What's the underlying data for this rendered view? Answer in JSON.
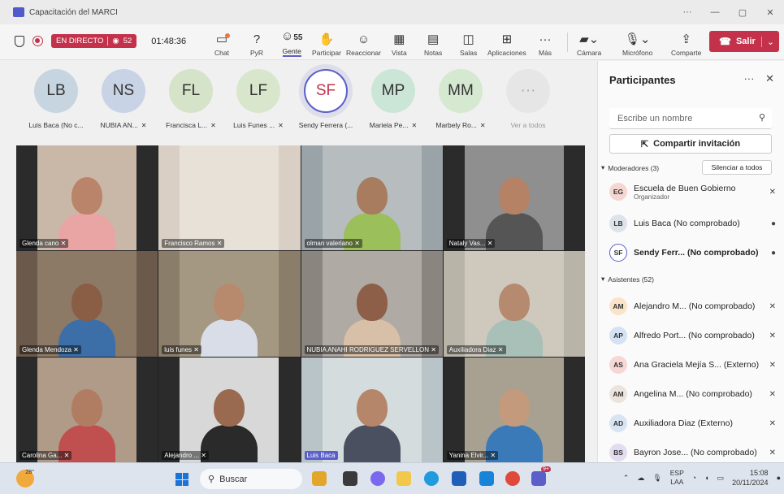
{
  "window": {
    "title": "Capacitación del MARCI",
    "more": "···",
    "minimize": "—",
    "restore": "▢",
    "close": "✕"
  },
  "toolbar": {
    "live_label": "EN DIRECTO",
    "viewers": "52",
    "timer": "01:48:36",
    "people_count": "55",
    "buttons": [
      {
        "label": "Chat",
        "icon": "chat-icon"
      },
      {
        "label": "PyR",
        "icon": "qa-icon"
      },
      {
        "label": "Gente",
        "icon": "people-icon"
      },
      {
        "label": "Participar",
        "icon": "raise-hand-icon"
      },
      {
        "label": "Reaccionar",
        "icon": "smiley-icon"
      },
      {
        "label": "Vista",
        "icon": "grid-icon"
      },
      {
        "label": "Notas",
        "icon": "notes-icon"
      },
      {
        "label": "Salas",
        "icon": "rooms-icon"
      },
      {
        "label": "Aplicaciones",
        "icon": "plus-square-icon"
      },
      {
        "label": "Más",
        "icon": "ellipsis-icon"
      }
    ],
    "camera": "Cámara",
    "mic": "Micrófono",
    "share": "Comparte",
    "leave": "Salir"
  },
  "avatars": [
    {
      "initials": "LB",
      "name": "Luis Baca (No c...",
      "color": "#c7d5e0",
      "muted": false
    },
    {
      "initials": "NS",
      "name": "NUBIA AN...",
      "color": "#c9d3e6",
      "muted": true
    },
    {
      "initials": "FL",
      "name": "Francisca L...",
      "color": "#d5e3c9",
      "muted": true
    },
    {
      "initials": "LF",
      "name": "Luis Funes ...",
      "color": "#d8e6cc",
      "muted": true
    },
    {
      "initials": "SF",
      "name": "Sendy Ferrera (...",
      "color": "#f3dede",
      "muted": false
    },
    {
      "initials": "MP",
      "name": "Mariela Pe...",
      "color": "#cbe6d6",
      "muted": true
    },
    {
      "initials": "MM",
      "name": "Marbely Ro...",
      "color": "#d5e8d0",
      "muted": true
    },
    {
      "initials": "···",
      "name": "Ver a todos",
      "color": "#e6e6e6",
      "muted": false
    }
  ],
  "tiles": [
    {
      "name": "Glenda cano",
      "bg": "#2b2b2b",
      "scene": "#c9b8a8",
      "skin": "#b9846a",
      "shirt": "#e9a4a4"
    },
    {
      "name": "Francisco  Ramos",
      "bg": "#d9cfc4",
      "scene": "#e8e1d8",
      "skin": "#d9cfc4",
      "shirt": "#d9cfc4"
    },
    {
      "name": "olman valeriano",
      "bg": "#9aa3a8",
      "scene": "#b7bcbf",
      "skin": "#a87c5f",
      "shirt": "#9bbf5a"
    },
    {
      "name": "Nataly Vas...",
      "bg": "#2b2b2b",
      "scene": "#8f8f8f",
      "skin": "#b58266",
      "shirt": "#555555"
    },
    {
      "name": "Glenda Mendoza",
      "bg": "#6b5a4b",
      "scene": "#8d7a66",
      "skin": "#8a5d45",
      "shirt": "#3c6fa8"
    },
    {
      "name": "luis funes",
      "bg": "#8a7d6a",
      "scene": "#a59883",
      "skin": "#b88a6d",
      "shirt": "#d8dde8"
    },
    {
      "name": "NUBIA ANAHI RODRIGUEZ SERVELLON",
      "bg": "#8b8580",
      "scene": "#b0aaa4",
      "skin": "#8d5f48",
      "shirt": "#d8c0a8"
    },
    {
      "name": "Auxiliadora Diaz",
      "bg": "#b9b4a8",
      "scene": "#cfc9bd",
      "skin": "#b58a6f",
      "shirt": "#a8c0b8"
    },
    {
      "name": "Carolina Ga...",
      "bg": "#2b2b2b",
      "scene": "#b09a88",
      "skin": "#b07d63",
      "shirt": "#c05050"
    },
    {
      "name": "Alejandro ...",
      "bg": "#2b2b2b",
      "scene": "#d8d8d8",
      "skin": "#9a6a50",
      "shirt": "#2a2a2a"
    },
    {
      "name": "Luis Baca",
      "bg": "#b8c4c8",
      "scene": "#d4dcde",
      "skin": "#b5866a",
      "shirt": "#4a5060"
    },
    {
      "name": "Yanina Elvir...",
      "bg": "#2b2b2b",
      "scene": "#a8a090",
      "skin": "#c49a7c",
      "shirt": "#3a7ab8"
    }
  ],
  "panel": {
    "title": "Participantes",
    "more": "···",
    "close": "✕",
    "search_placeholder": "Escribe un nombre",
    "share_invite": "Compartir invitación",
    "moderators_label": "Moderadores (3)",
    "mute_all": "Silenciar a todos",
    "attendees_label": "Asistentes (52)",
    "moderators": [
      {
        "initials": "EG",
        "name": "Escuela de Buen Gobierno",
        "sub": "Organizador",
        "color": "#f6d6d0",
        "mic": "muted"
      },
      {
        "initials": "LB",
        "name": "Luis Baca (No comprobado)",
        "sub": "",
        "color": "#dde3ea",
        "mic": "on"
      },
      {
        "initials": "SF",
        "name": "Sendy Ferr...  (No comprobado)",
        "sub": "",
        "color": "#ffffff",
        "mic": "on"
      }
    ],
    "attendees": [
      {
        "initials": "AM",
        "name": "Alejandro M... (No comprobado)",
        "color": "#fbe3c8"
      },
      {
        "initials": "AP",
        "name": "Alfredo Port... (No comprobado)",
        "color": "#d5e2f3"
      },
      {
        "initials": "AS",
        "name": "Ana Graciela Mejía S... (Externo)",
        "color": "#f7d7d5"
      },
      {
        "initials": "AM",
        "name": "Angelina M...  (No comprobado)",
        "color": "#ece4dc"
      },
      {
        "initials": "AD",
        "name": "Auxiliadora Diaz (Externo)",
        "color": "#d9e4f3"
      },
      {
        "initials": "BS",
        "name": "Bayron Jose... (No comprobado)",
        "color": "#e3dcf0"
      }
    ]
  },
  "taskbar": {
    "temp": "28°",
    "search": "Buscar",
    "notif_badge": "9+",
    "lang_top": "ESP",
    "lang_bottom": "LAA",
    "time": "15:08",
    "date": "20/11/2024"
  }
}
